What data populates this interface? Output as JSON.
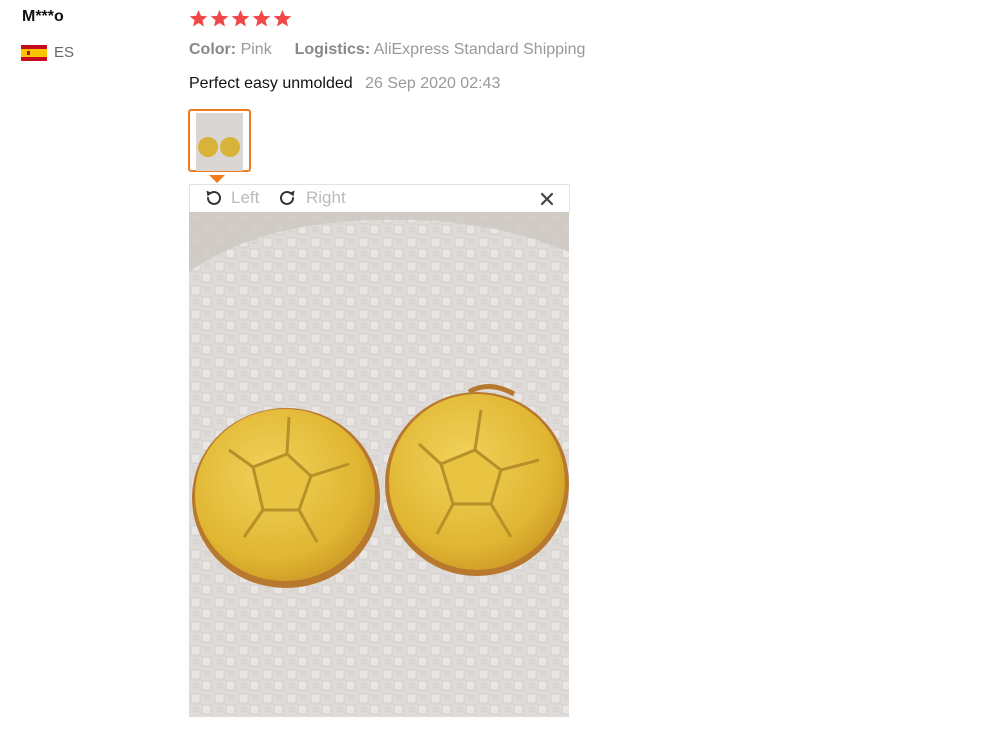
{
  "user": {
    "name": "M***o",
    "country_code": "ES",
    "flag_icon": "spain-flag-icon"
  },
  "rating": {
    "stars": 5,
    "max": 5,
    "star_color": "#f04848"
  },
  "meta": {
    "color_label": "Color:",
    "color_value": "Pink",
    "logistics_label": "Logistics:",
    "logistics_value": "AliExpress Standard Shipping"
  },
  "review": {
    "text": "Perfect easy unmolded",
    "date": "26 Sep 2020 02:43"
  },
  "viewer": {
    "rotate_left_label": "Left",
    "rotate_right_label": "Right",
    "close_icon": "close-icon",
    "accent_color": "#f07c1e"
  }
}
